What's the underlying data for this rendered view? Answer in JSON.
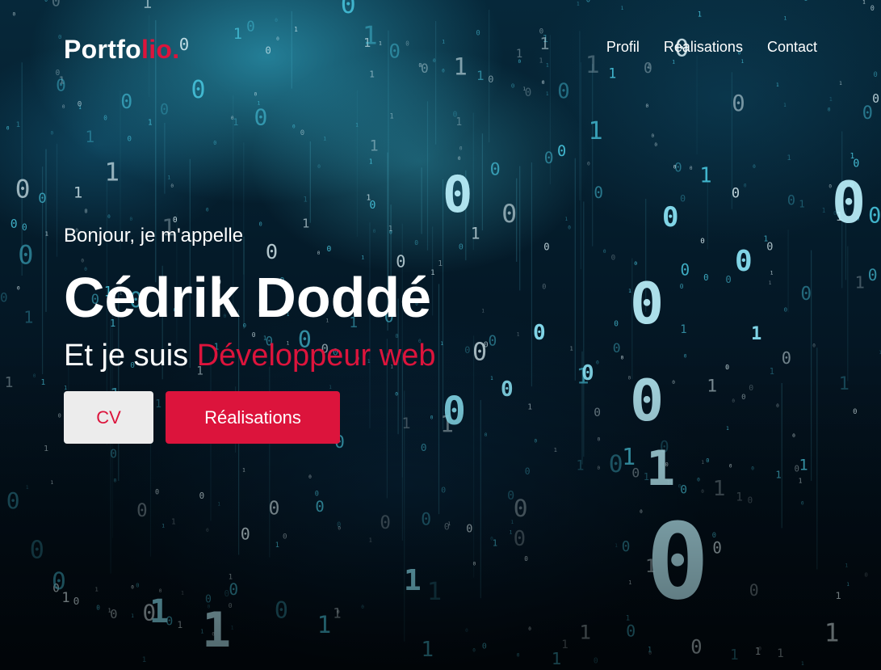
{
  "nav": {
    "logo_main": "Portfo",
    "logo_accent": "lio.",
    "links": [
      "Profil",
      "Réalisations",
      "Contact"
    ]
  },
  "hero": {
    "greeting": "Bonjour, je m'appelle",
    "name": "Cédrik Doddé",
    "role_prefix": "Et je suis",
    "role_highlight": "Développeur web",
    "buttons": {
      "cv": "CV",
      "realisations": "Réalisations"
    }
  },
  "background": {
    "description_icon": "binary-rain-background",
    "glyphs": [
      "0",
      "1"
    ]
  },
  "colors": {
    "accent": "#dc143c",
    "text": "#ffffff",
    "button_light": "#ececec",
    "background_dark": "#02070c",
    "digit_cyan": "#4fd6ef"
  }
}
